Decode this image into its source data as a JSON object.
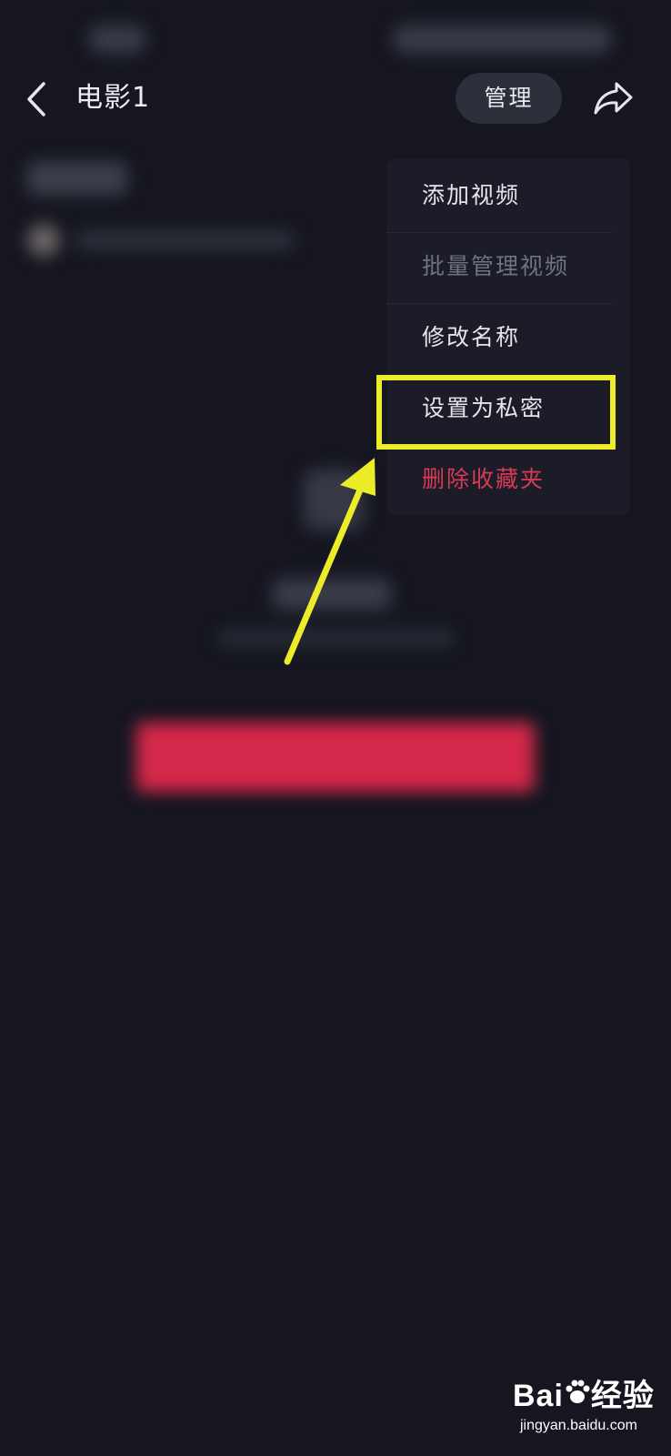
{
  "header": {
    "title": "电影1",
    "manage_label": "管理",
    "back_icon": "chevron-left-icon",
    "share_icon": "share-arrow-icon"
  },
  "menu": {
    "items": [
      {
        "label": "添加视频",
        "state": "normal"
      },
      {
        "label": "批量管理视频",
        "state": "disabled"
      },
      {
        "label": "修改名称",
        "state": "normal"
      },
      {
        "label": "设置为私密",
        "state": "highlighted"
      },
      {
        "label": "删除收藏夹",
        "state": "danger"
      }
    ]
  },
  "annotation": {
    "highlight_color": "#ecec28",
    "arrow_color": "#ecec28"
  },
  "colors": {
    "background": "#151620",
    "menu_background": "#1b1c27",
    "danger": "#d73a55",
    "blurred_button": "#d6284a"
  },
  "watermark": {
    "logo_prefix": "Bai",
    "logo_suffix": "经验",
    "url": "jingyan.baidu.com"
  }
}
